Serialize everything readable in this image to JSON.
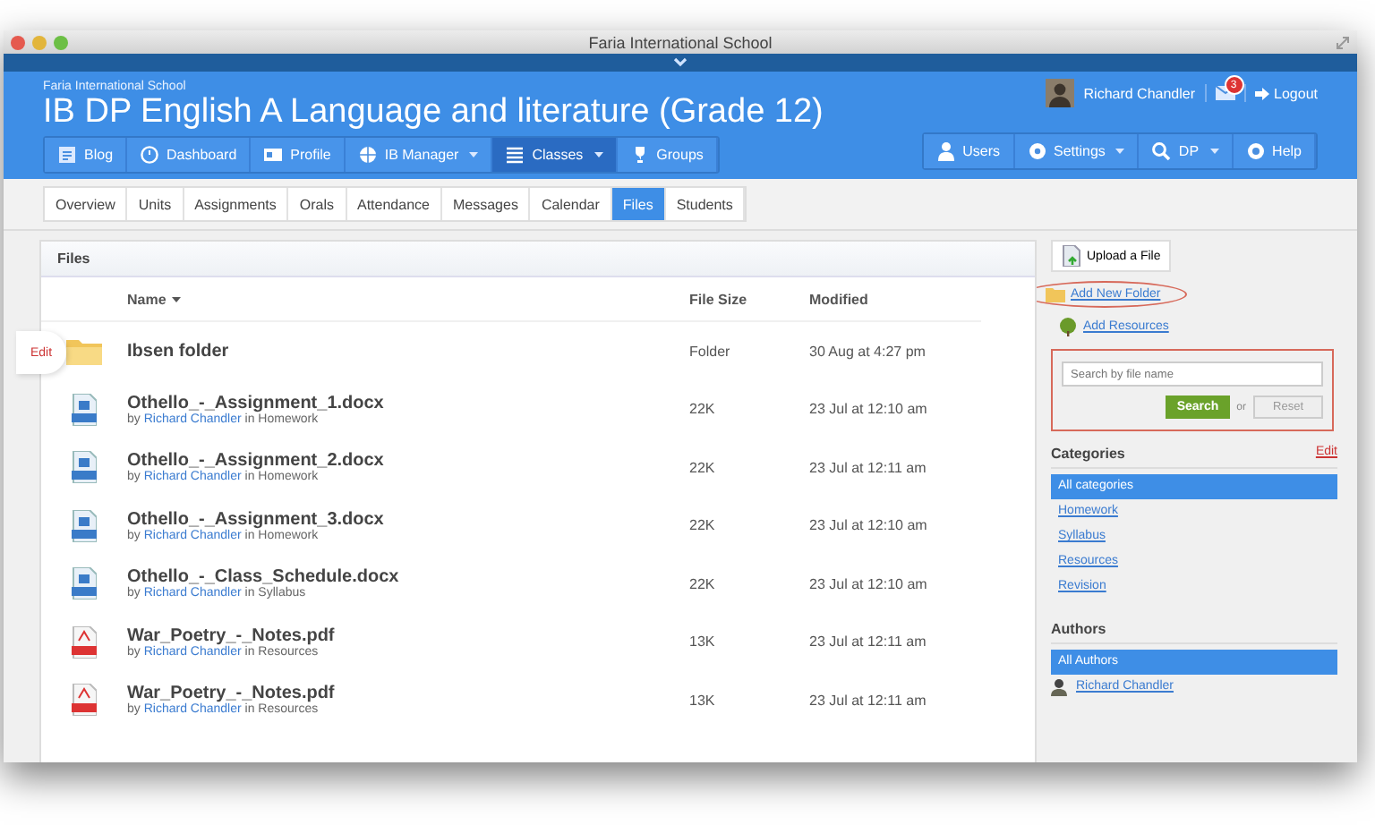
{
  "window": {
    "title": "Faria International School"
  },
  "header": {
    "school": "Faria International School",
    "course": "IB DP English A Language and literature (Grade 12)",
    "user": "Richard Chandler",
    "notifications": "3",
    "logout": "Logout"
  },
  "nav": [
    {
      "label": "Blog",
      "dropdown": false,
      "selected": false
    },
    {
      "label": "Dashboard",
      "dropdown": false,
      "selected": false
    },
    {
      "label": "Profile",
      "dropdown": false,
      "selected": false
    },
    {
      "label": "IB Manager",
      "dropdown": true,
      "selected": false
    },
    {
      "label": "Classes",
      "dropdown": true,
      "selected": true
    },
    {
      "label": "Groups",
      "dropdown": false,
      "selected": false
    }
  ],
  "nav_right": [
    {
      "label": "Users",
      "dropdown": false
    },
    {
      "label": "Settings",
      "dropdown": true
    },
    {
      "label": "DP",
      "dropdown": true
    },
    {
      "label": "Help",
      "dropdown": false
    }
  ],
  "tabs": [
    {
      "label": "Overview",
      "selected": false
    },
    {
      "label": "Units",
      "selected": false
    },
    {
      "label": "Assignments",
      "selected": false
    },
    {
      "label": "Orals",
      "selected": false
    },
    {
      "label": "Attendance",
      "selected": false
    },
    {
      "label": "Messages",
      "selected": false
    },
    {
      "label": "Calendar",
      "selected": false
    },
    {
      "label": "Files",
      "selected": true
    },
    {
      "label": "Students",
      "selected": false
    }
  ],
  "files": {
    "title": "Files",
    "columns": [
      "Name",
      "File Size",
      "Modified"
    ],
    "rows": [
      {
        "kind": "folder",
        "name": "Ibsen folder",
        "size": "Folder",
        "modified": "30 Aug at 4:27 pm",
        "edit_label": "Edit"
      },
      {
        "kind": "doc",
        "name": "Othello_-_Assignment_1.docx",
        "by": "by",
        "author": "Richard Chandler",
        "in": "in Homework",
        "size": "22K",
        "modified": "23 Jul at 12:10 am"
      },
      {
        "kind": "doc",
        "name": "Othello_-_Assignment_2.docx",
        "by": "by",
        "author": "Richard Chandler",
        "in": "in Homework",
        "size": "22K",
        "modified": "23 Jul at 12:11 am"
      },
      {
        "kind": "doc",
        "name": "Othello_-_Assignment_3.docx",
        "by": "by",
        "author": "Richard Chandler",
        "in": "in Homework",
        "size": "22K",
        "modified": "23 Jul at 12:10 am"
      },
      {
        "kind": "doc",
        "name": "Othello_-_Class_Schedule.docx",
        "by": "by",
        "author": "Richard Chandler",
        "in": "in Syllabus",
        "size": "22K",
        "modified": "23 Jul at 12:10 am"
      },
      {
        "kind": "pdf",
        "name": "War_Poetry_-_Notes.pdf",
        "by": "by",
        "author": "Richard Chandler",
        "in": "in Resources",
        "size": "13K",
        "modified": "23 Jul at 12:11 am"
      },
      {
        "kind": "pdf",
        "name": "War_Poetry_-_Notes.pdf",
        "by": "by",
        "author": "Richard Chandler",
        "in": "in Resources",
        "size": "13K",
        "modified": "23 Jul at 12:11 am"
      }
    ]
  },
  "sidebar": {
    "upload": "Upload a File",
    "links": [
      {
        "label": "Add New Folder",
        "highlighted": true
      },
      {
        "label": "Add Resources",
        "highlighted": false
      }
    ],
    "search": {
      "placeholder": "Search by file name",
      "button": "Search",
      "or": "or",
      "reset": "Reset",
      "highlighted": true
    },
    "categories": {
      "title": "Categories",
      "edit": "Edit",
      "items": [
        {
          "label": "All categories",
          "selected": true
        },
        {
          "label": "Homework",
          "selected": false
        },
        {
          "label": "Syllabus",
          "selected": false
        },
        {
          "label": "Resources",
          "selected": false
        },
        {
          "label": "Revision",
          "selected": false
        }
      ]
    },
    "authors": {
      "title": "Authors",
      "items": [
        {
          "label": "All Authors",
          "selected": true,
          "avatar": false
        },
        {
          "label": "Richard Chandler",
          "selected": false,
          "avatar": true
        }
      ]
    }
  }
}
